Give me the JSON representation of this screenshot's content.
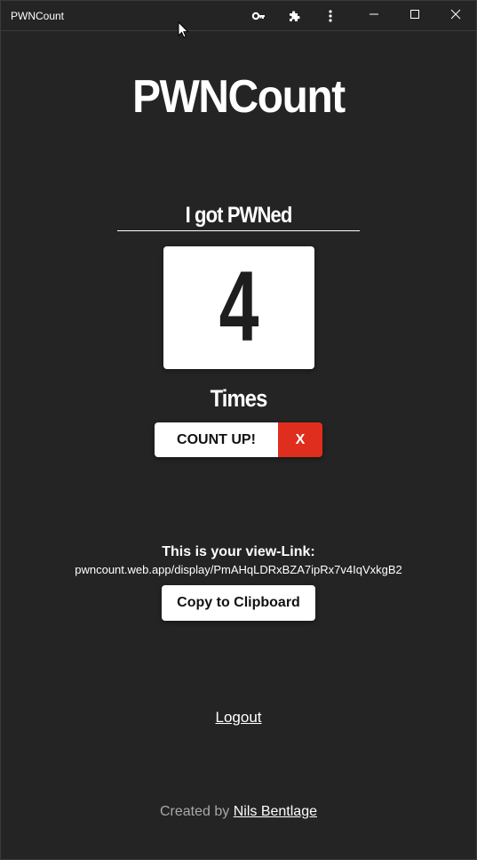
{
  "window": {
    "title": "PWNCount"
  },
  "main": {
    "title": "PWNCount",
    "counter_label": "I got PWNed",
    "counter_value": "4",
    "times_label": "Times",
    "count_up_label": "COUNT UP!",
    "reset_label": "X",
    "reset_color": "#e02e1e"
  },
  "share": {
    "heading": "This is your view-Link:",
    "link": "pwncount.web.app/display/PmAHqLDRxBZA7ipRx7v4IqVxkgB2",
    "copy_label": "Copy to Clipboard"
  },
  "logout_label": "Logout",
  "footer": {
    "prefix": "Created by",
    "author": "Nils Bentlage"
  },
  "icons": {
    "titlebar": [
      "key-icon",
      "puzzle-icon",
      "more-vertical-icon",
      "minimize-icon",
      "maximize-icon",
      "close-icon"
    ]
  }
}
